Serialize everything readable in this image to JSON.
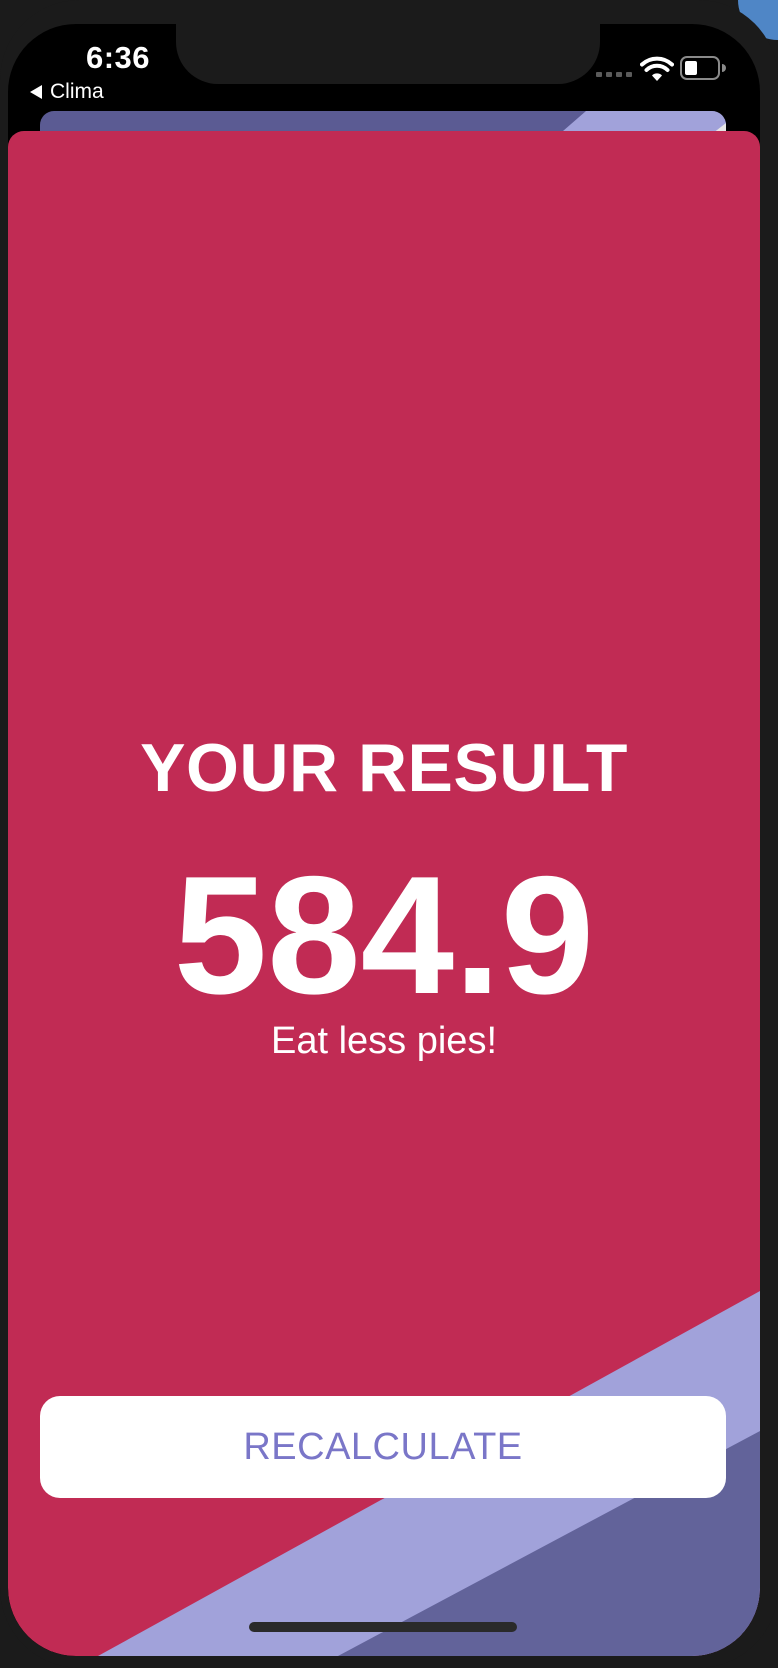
{
  "status_bar": {
    "time": "6:36",
    "back_app_label": "Clima",
    "icons": [
      "cellular-signal-icon",
      "wifi-icon",
      "battery-icon"
    ]
  },
  "result": {
    "title": "YOUR RESULT",
    "value": "584.9",
    "advice": "Eat less pies!"
  },
  "actions": {
    "recalculate_label": "RECALCULATE"
  },
  "colors": {
    "card_background": "#c12b54",
    "stripe_light": "#a1a2da",
    "stripe_dark": "#62639a",
    "button_text": "#7a76c8"
  }
}
